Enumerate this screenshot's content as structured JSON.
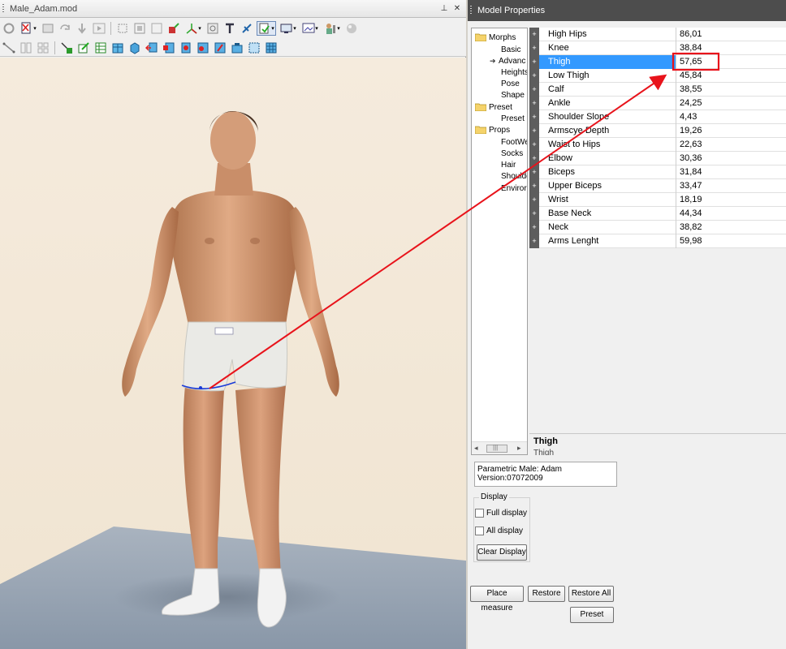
{
  "document_window": {
    "title": "Male_Adam.mod",
    "pin_icon": "pin-icon",
    "close_icon": "close-icon"
  },
  "toolbar": {
    "row1_icons": [
      "recycle-icon",
      "new-document-icon",
      "open-icon",
      "redo-icon",
      "down-arrow-icon",
      "play-icon",
      "frame-icon",
      "fit-icon",
      "zoom-icon",
      "pick-icon",
      "axis-icon",
      "texture-icon",
      "text-icon",
      "shape-icon",
      "select-icon",
      "display-icon",
      "viewport-icon",
      "material-icon",
      "sphere-icon"
    ],
    "row2_icons": [
      "measure-line-icon",
      "split-icon",
      "grid-icon",
      "add-icon",
      "edit-icon",
      "table-icon",
      "box-icon",
      "cylinder-icon",
      "move-icon",
      "rotate-icon",
      "scale-icon",
      "morph-icon",
      "pose-icon",
      "camera-icon",
      "select-all-icon",
      "select-none-icon"
    ]
  },
  "properties_panel": {
    "title": "Model Properties",
    "tree": [
      {
        "label": "Morphs",
        "level": 0,
        "icon": "folder-icon"
      },
      {
        "label": "Basic",
        "level": 1
      },
      {
        "label": "Advanc",
        "level": 1,
        "selected": true
      },
      {
        "label": "Heights",
        "level": 1
      },
      {
        "label": "Pose",
        "level": 1
      },
      {
        "label": "Shape",
        "level": 1
      },
      {
        "label": "Preset",
        "level": 0,
        "icon": "folder-icon"
      },
      {
        "label": "Preset",
        "level": 1
      },
      {
        "label": "Props",
        "level": 0,
        "icon": "folder-icon"
      },
      {
        "label": "FootWe",
        "level": 1
      },
      {
        "label": "Socks",
        "level": 1
      },
      {
        "label": "Hair",
        "level": 1
      },
      {
        "label": "Shoulde",
        "level": 1
      },
      {
        "label": "Enviror",
        "level": 1
      }
    ],
    "properties": [
      {
        "name": "High Hips",
        "value": "86,01"
      },
      {
        "name": "Knee",
        "value": "38,84"
      },
      {
        "name": "Thigh",
        "value": "57,65",
        "selected": true
      },
      {
        "name": "Low Thigh",
        "value": "45,84"
      },
      {
        "name": "Calf",
        "value": "38,55"
      },
      {
        "name": "Ankle",
        "value": "24,25"
      },
      {
        "name": "Shoulder Slope",
        "value": "4,43"
      },
      {
        "name": "Armscye Depth",
        "value": "19,26"
      },
      {
        "name": "Waist to Hips",
        "value": "22,63"
      },
      {
        "name": "Elbow",
        "value": "30,36"
      },
      {
        "name": "Biceps",
        "value": "31,84"
      },
      {
        "name": "Upper Biceps",
        "value": "33,47"
      },
      {
        "name": "Wrist",
        "value": "18,19"
      },
      {
        "name": "Base Neck",
        "value": "44,34"
      },
      {
        "name": "Neck",
        "value": "38,82"
      },
      {
        "name": "Arms Lenght",
        "value": "59,98"
      }
    ],
    "description": {
      "title": "Thigh",
      "subtitle": "Thigh"
    },
    "info": {
      "line1": "Parametric Male: Adam",
      "line2": "Version:07072009"
    },
    "display_group": {
      "legend": "Display",
      "full_display": {
        "label": "Full display",
        "checked": false
      },
      "all_display": {
        "label": "All display",
        "checked": false
      },
      "clear_button": "Clear Display"
    },
    "buttons": {
      "place_measure": "Place measure",
      "restore": "Restore",
      "restore_all": "Restore All",
      "preset": "Preset"
    }
  },
  "colors": {
    "selection": "#3399ff",
    "annotation": "#e8131b",
    "measure_line": "#1a3bd8",
    "panel_title": "#4d4d4d"
  }
}
